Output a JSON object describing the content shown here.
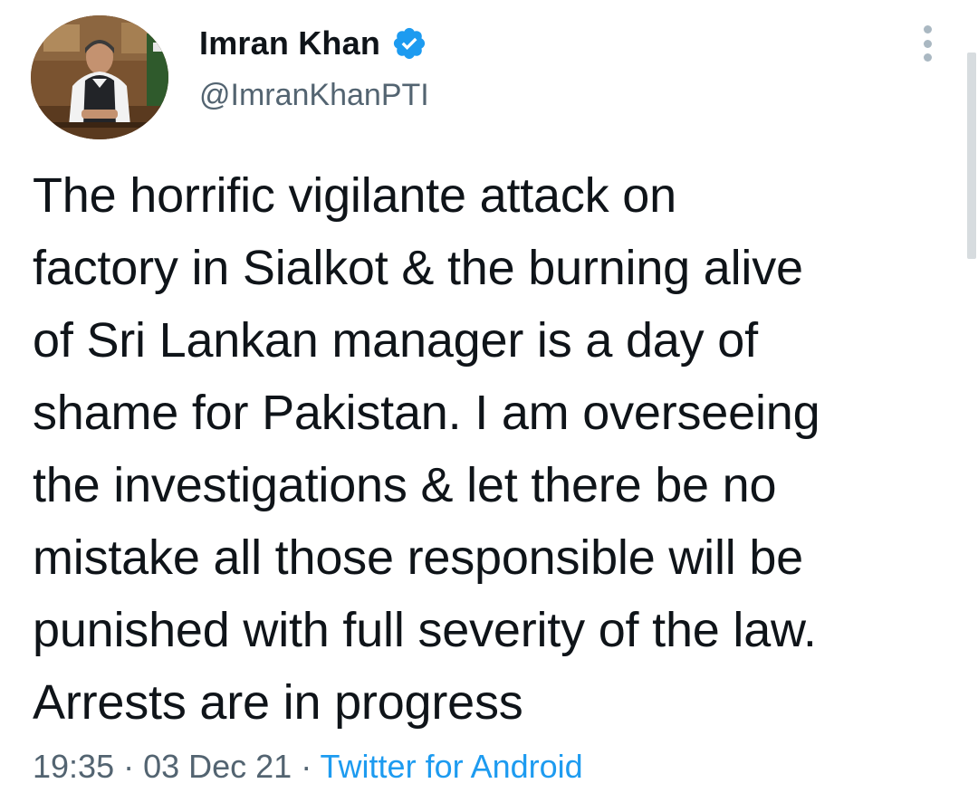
{
  "tweet": {
    "author": {
      "display_name": "Imran Khan",
      "handle": "@ImranKhanPTI",
      "verified": true
    },
    "text": "The horrific vigilante attack on\nfactory in Sialkot & the burning alive\nof Sri Lankan manager is a day of\nshame for Pakistan. I am overseeing\nthe investigations & let there be no\nmistake all those responsible will be\npunished with full severity of the law.\nArrests are in progress",
    "time": "19:35",
    "separator": " · ",
    "date": "03 Dec 21",
    "source": "Twitter for Android"
  },
  "icons": {
    "verified": "verified-badge-icon",
    "more": "more-vertical-icon"
  },
  "colors": {
    "verified": "#1d9bf0",
    "source_link": "#1d9bf0",
    "secondary_text": "#536471",
    "primary_text": "#0f1419"
  }
}
